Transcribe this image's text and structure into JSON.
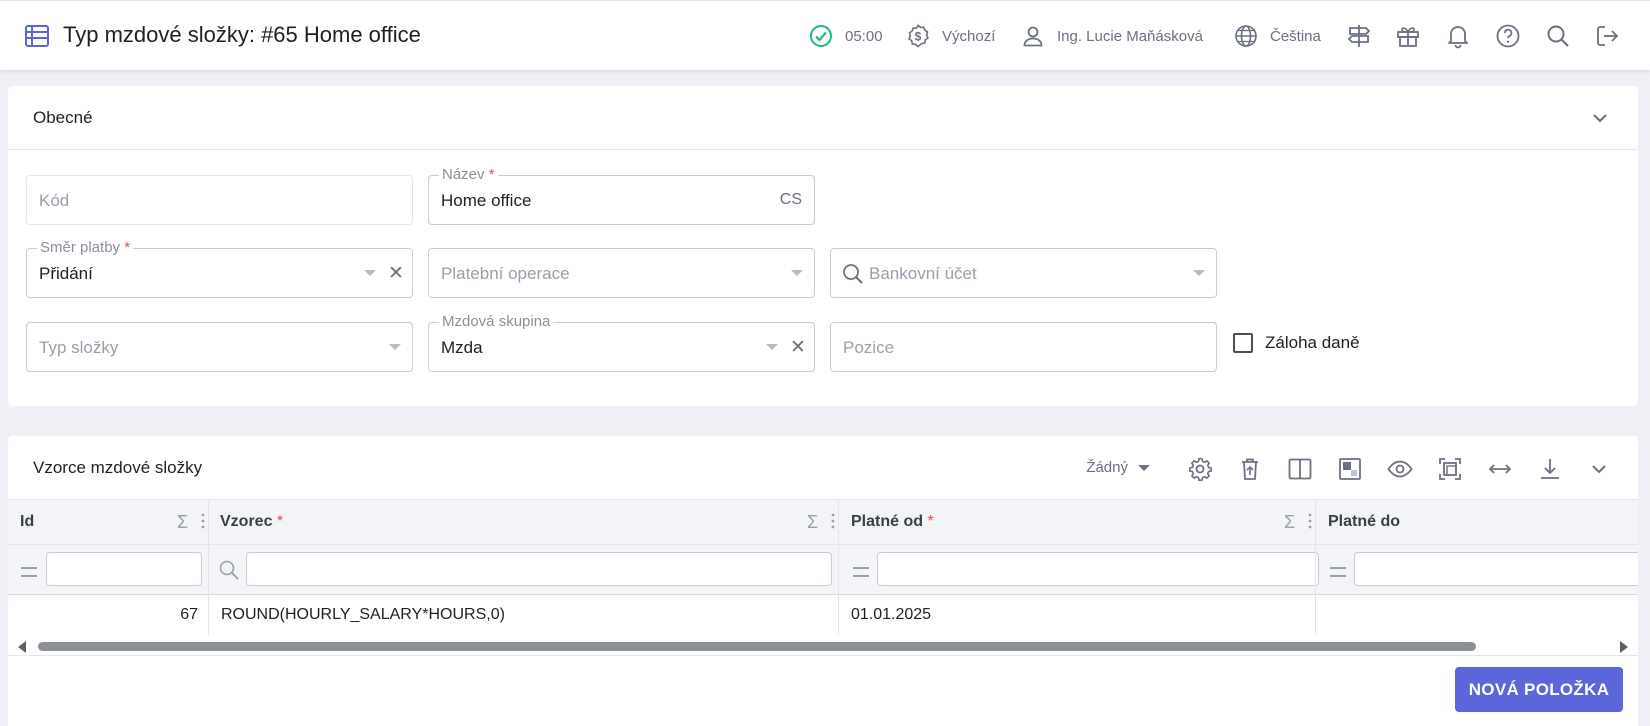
{
  "header": {
    "title": "Typ mzdové složky: #65 Home office",
    "timer": "05:00",
    "currency_profile": "Výchozí",
    "user": "Ing. Lucie Maňásková",
    "language": "Čeština"
  },
  "general": {
    "title": "Obecné",
    "fields": {
      "kod": {
        "placeholder": "Kód",
        "value": ""
      },
      "nazev": {
        "label": "Název",
        "value": "Home office",
        "lang": "CS"
      },
      "smer_platby": {
        "label": "Směr platby",
        "value": "Přidání"
      },
      "platebni_operace": {
        "placeholder": "Platební operace"
      },
      "bankovni_ucet": {
        "placeholder": "Bankovní účet"
      },
      "typ_slozky": {
        "placeholder": "Typ složky"
      },
      "mzdova_skupina": {
        "label": "Mzdová skupina",
        "value": "Mzda"
      },
      "pozice": {
        "placeholder": "Pozice"
      },
      "zaloha_dane": {
        "label": "Záloha daně",
        "checked": false
      }
    },
    "required_mark": "*"
  },
  "table": {
    "title": "Vzorce mzdové složky",
    "group_select": "Žádný",
    "sigma": "Σ",
    "columns": [
      {
        "label": "Id",
        "required": false
      },
      {
        "label": "Vzorec",
        "required": true
      },
      {
        "label": "Platné od",
        "required": true
      },
      {
        "label": "Platné do",
        "required": false
      }
    ],
    "rows": [
      {
        "id": "67",
        "vzorec": "ROUND(HOURLY_SALARY*HOURS,0)",
        "platne_od": "01.01.2025",
        "platne_do": ""
      }
    ],
    "new_button": "NOVÁ POLOŽKA"
  },
  "colors": {
    "accent": "#5a66d9",
    "required": "#e24b4b",
    "success": "#1fb874"
  }
}
